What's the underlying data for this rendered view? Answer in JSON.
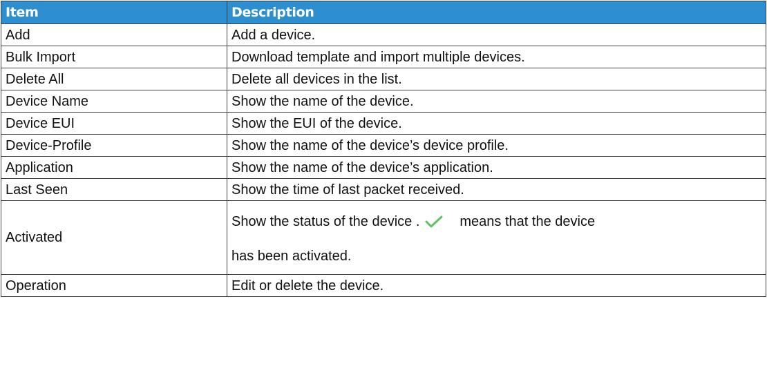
{
  "table": {
    "headers": {
      "item": "Item",
      "description": "Description"
    },
    "rows": [
      {
        "item": "Add",
        "description": "Add a device."
      },
      {
        "item": "Bulk Import",
        "description": "Download template and import multiple devices."
      },
      {
        "item": "Delete All",
        "description": "Delete all devices in the list."
      },
      {
        "item": "Device Name",
        "description": "Show the name of the device."
      },
      {
        "item": "Device EUI",
        "description": "Show the EUI of the device."
      },
      {
        "item": "Device-Profile",
        "description": "Show the name of the device’s device profile."
      },
      {
        "item": "Application",
        "description": "Show the name of the device’s application."
      },
      {
        "item": "Last Seen",
        "description": "Show the time of last packet received."
      },
      {
        "item": "Activated",
        "description_before_icon": "Show the status of the device .",
        "description_icon": "check-icon",
        "description_after_icon": "means that the device",
        "description_line2": "has been activated."
      },
      {
        "item": "Operation",
        "description": "Edit or delete the device."
      }
    ]
  },
  "colors": {
    "header_background": "#2d8fd0",
    "header_text": "#ffffff",
    "border": "#3d3d3d",
    "check_icon": "#5cc45e"
  }
}
